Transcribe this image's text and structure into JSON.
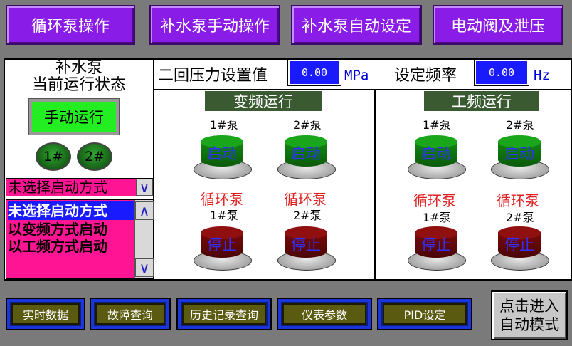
{
  "nav": {
    "btn1": "循环泵操作",
    "btn2": "补水泵手动操作",
    "btn3": "补水泵自动设定",
    "btn4": "电动阀及泄压"
  },
  "status": {
    "title_line1": "补水泵",
    "title_line2": "当前运行状态",
    "mode": "手动运行",
    "pump1": "1#",
    "pump2": "2#"
  },
  "settings": {
    "pressure_label": "二回压力设置值",
    "pressure_value": "0.00",
    "pressure_unit": "MPa",
    "freq_label": "设定频率",
    "freq_value": "0.00",
    "freq_unit": "Hz"
  },
  "startmode": {
    "selected": "未选择启动方式",
    "options": [
      "未选择启动方式",
      "以变频方式启动",
      "以工频方式启动"
    ]
  },
  "vf": {
    "title": "变频运行",
    "pump1_label": "1#泵",
    "pump2_label": "2#泵",
    "start": "启动",
    "circ": "循环泵",
    "stop": "停止"
  },
  "pf": {
    "title": "工频运行",
    "pump1_label": "1#泵",
    "pump2_label": "2#泵",
    "start": "启动",
    "circ": "循环泵",
    "stop": "停止"
  },
  "toolbar": {
    "realtime": "实时数据",
    "fault": "故障查询",
    "history": "历史记录查询",
    "instrument": "仪表参数",
    "pid": "PID设定",
    "auto_line1": "点击进入",
    "auto_line2": "自动模式"
  },
  "colors": {
    "nav_purple": "#8a1ce8",
    "value_box": "#1a1aff",
    "mode_green": "#22ee22",
    "list_pink": "#ff1493"
  }
}
